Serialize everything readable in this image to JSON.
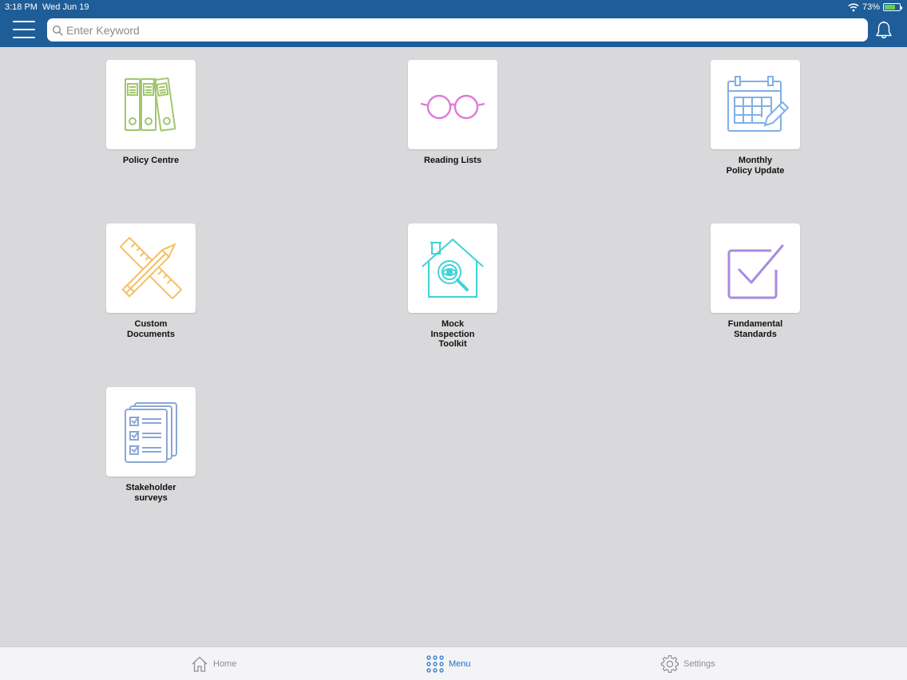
{
  "status": {
    "time": "3:18 PM",
    "date": "Wed Jun 19",
    "battery_label": "73%",
    "battery_level": 0.73
  },
  "search": {
    "placeholder": "Enter Keyword",
    "value": ""
  },
  "icons": {
    "menu": "hamburger-menu-icon",
    "search": "magnifier-icon",
    "notifications": "bell-icon"
  },
  "tiles": [
    {
      "label": "Policy Centre",
      "icon": "binders-icon",
      "color": "#a3c56e"
    },
    {
      "label": "Reading Lists",
      "icon": "glasses-icon",
      "color": "#e07ad9"
    },
    {
      "label": "Monthly\nPolicy Update",
      "icon": "calendar-edit-icon",
      "color": "#7fb0e6"
    },
    {
      "label": "Custom\nDocuments",
      "icon": "ruler-pencil-icon",
      "color": "#f5c061"
    },
    {
      "label": "Mock\nInspection\nToolkit",
      "icon": "house-inspection-icon",
      "color": "#3fd3d6"
    },
    {
      "label": "Fundamental\nStandards",
      "icon": "checkbox-icon",
      "color": "#a98be0"
    },
    {
      "label": "Stakeholder\nsurveys",
      "icon": "survey-checklist-icon",
      "color": "#8aa7d6"
    }
  ],
  "tabbar": {
    "active_color": "#1f6fc9",
    "inactive_color": "#8e8e93",
    "items": [
      {
        "label": "Home",
        "icon": "house-icon",
        "active": false
      },
      {
        "label": "Menu",
        "icon": "grid-dots-icon",
        "active": true
      },
      {
        "label": "Settings",
        "icon": "gear-icon",
        "active": false
      }
    ]
  }
}
